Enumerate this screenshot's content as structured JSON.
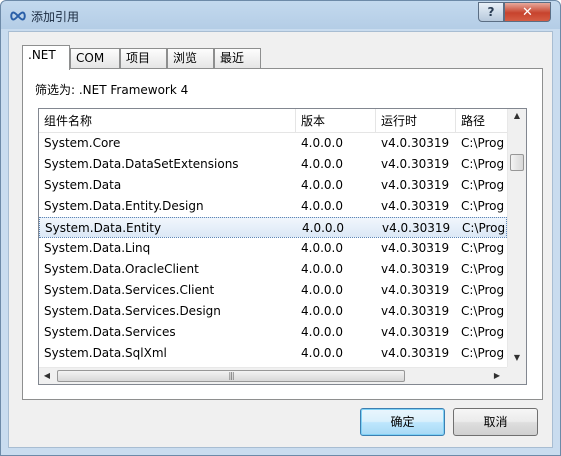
{
  "window": {
    "title": "添加引用",
    "help_label": "?",
    "close_label": "✕",
    "icon": "infinity-link-icon"
  },
  "tabs": [
    {
      "label": ".NET",
      "active": true
    },
    {
      "label": "COM",
      "active": false
    },
    {
      "label": "项目",
      "active": false
    },
    {
      "label": "浏览",
      "active": false
    },
    {
      "label": "最近",
      "active": false
    }
  ],
  "filter": {
    "text": "筛选为: .NET Framework 4"
  },
  "list": {
    "columns": [
      "组件名称",
      "版本",
      "运行时",
      "路径"
    ],
    "rows": [
      {
        "name": "System.Core",
        "version": "4.0.0.0",
        "runtime": "v4.0.30319",
        "path": "C:\\Prog",
        "selected": false
      },
      {
        "name": "System.Data.DataSetExtensions",
        "version": "4.0.0.0",
        "runtime": "v4.0.30319",
        "path": "C:\\Prog",
        "selected": false
      },
      {
        "name": "System.Data",
        "version": "4.0.0.0",
        "runtime": "v4.0.30319",
        "path": "C:\\Prog",
        "selected": false
      },
      {
        "name": "System.Data.Entity.Design",
        "version": "4.0.0.0",
        "runtime": "v4.0.30319",
        "path": "C:\\Prog",
        "selected": false
      },
      {
        "name": "System.Data.Entity",
        "version": "4.0.0.0",
        "runtime": "v4.0.30319",
        "path": "C:\\Prog",
        "selected": true
      },
      {
        "name": "System.Data.Linq",
        "version": "4.0.0.0",
        "runtime": "v4.0.30319",
        "path": "C:\\Prog",
        "selected": false
      },
      {
        "name": "System.Data.OracleClient",
        "version": "4.0.0.0",
        "runtime": "v4.0.30319",
        "path": "C:\\Prog",
        "selected": false
      },
      {
        "name": "System.Data.Services.Client",
        "version": "4.0.0.0",
        "runtime": "v4.0.30319",
        "path": "C:\\Prog",
        "selected": false
      },
      {
        "name": "System.Data.Services.Design",
        "version": "4.0.0.0",
        "runtime": "v4.0.30319",
        "path": "C:\\Prog",
        "selected": false
      },
      {
        "name": "System.Data.Services",
        "version": "4.0.0.0",
        "runtime": "v4.0.30319",
        "path": "C:\\Prog",
        "selected": false
      },
      {
        "name": "System.Data.SqlXml",
        "version": "4.0.0.0",
        "runtime": "v4.0.30319",
        "path": "C:\\Prog",
        "selected": false
      }
    ],
    "hscroll_grip": "|||"
  },
  "buttons": {
    "ok_label": "确定",
    "cancel_label": "取消"
  },
  "colors": {
    "selection": "#dbe8f6",
    "close_button": "#c7432d",
    "default_button_border": "#3c7fb1"
  }
}
